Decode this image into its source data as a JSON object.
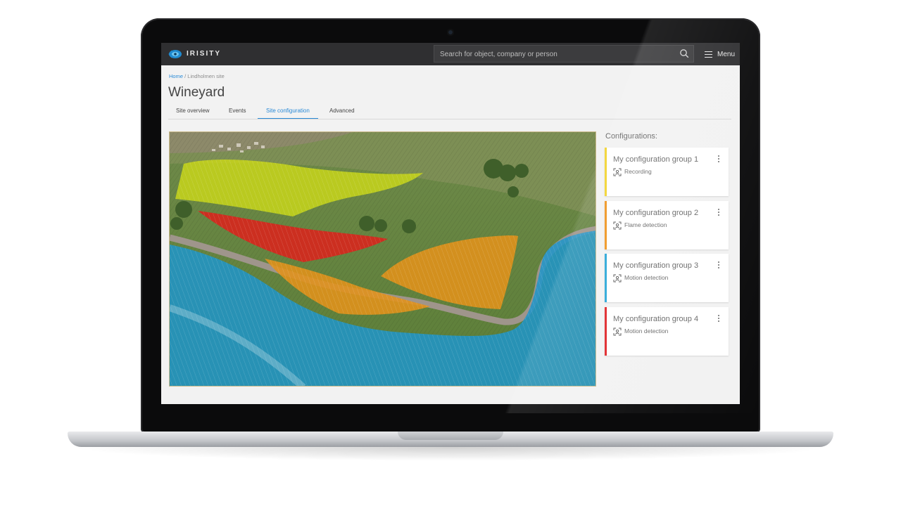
{
  "app": {
    "brand": "IRISITY"
  },
  "search": {
    "placeholder": "Search for object, company or person"
  },
  "header": {
    "menu_label": "Menu"
  },
  "breadcrumb": {
    "home": "Home",
    "separator": " / ",
    "current": "Lindholmen site"
  },
  "page": {
    "title": "Wineyard"
  },
  "tabs": [
    {
      "label": "Site overview",
      "active": false
    },
    {
      "label": "Events",
      "active": false
    },
    {
      "label": "Site configuration",
      "active": true
    },
    {
      "label": "Advanced",
      "active": false
    }
  ],
  "configurations": {
    "title": "Configurations:",
    "groups": [
      {
        "name": "My configuration group 1",
        "type": "Recording",
        "color": "#f2d32b"
      },
      {
        "name": "My configuration group 2",
        "type": "Flame detection",
        "color": "#f0951e"
      },
      {
        "name": "My configuration group 3",
        "type": "Motion detection",
        "color": "#2aa7d8"
      },
      {
        "name": "My configuration group 4",
        "type": "Motion detection",
        "color": "#e0262a"
      }
    ]
  },
  "colors": {
    "accent": "#2a8ad6",
    "topbar": "#2f2f31"
  }
}
